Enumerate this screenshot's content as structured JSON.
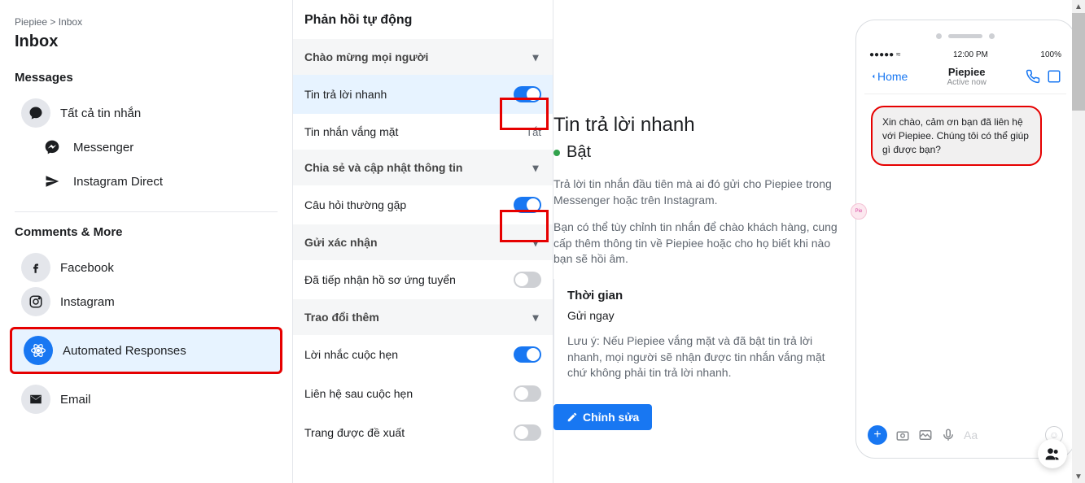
{
  "breadcrumb": {
    "page": "Piepiee",
    "section": "Inbox"
  },
  "inboxTitle": "Inbox",
  "sections": {
    "messages": "Messages",
    "comments": "Comments & More"
  },
  "nav": {
    "all": "Tất cả tin nhắn",
    "messenger": "Messenger",
    "instagramDirect": "Instagram Direct",
    "facebook": "Facebook",
    "instagram": "Instagram",
    "automated": "Automated Responses",
    "email": "Email"
  },
  "middle": {
    "title": "Phản hồi tự động",
    "groups": {
      "welcome": "Chào mừng mọi người",
      "share": "Chia sẻ và cập nhật thông tin",
      "confirm": "Gửi xác nhận",
      "more": "Trao đổi thêm"
    },
    "items": {
      "instantReply": "Tin trả lời nhanh",
      "awayMsg": "Tin nhắn vắng mặt",
      "awayStatus": "Tắt",
      "faq": "Câu hỏi thường gặp",
      "received": "Đã tiếp nhận hồ sơ ứng tuyển",
      "reminder": "Lời nhắc cuộc hẹn",
      "afterContact": "Liên hệ sau cuộc hẹn",
      "suggested": "Trang được đề xuất"
    }
  },
  "detail": {
    "title": "Tin trả lời nhanh",
    "status": "Bật",
    "desc1": "Trả lời tin nhắn đầu tiên mà ai đó gửi cho Piepiee trong Messenger hoặc trên Instagram.",
    "desc2": "Bạn có thể tùy chỉnh tin nhắn để chào khách hàng, cung cấp thêm thông tin về Piepiee hoặc cho họ biết khi nào bạn sẽ hồi âm.",
    "timeTitle": "Thời gian",
    "timeValue": "Gửi ngay",
    "note": "Lưu ý: Nếu Piepiee vắng mặt và đã bật tin trả lời nhanh, mọi người sẽ nhận được tin nhắn vắng mặt chứ không phải tin trả lời nhanh.",
    "editBtn": "Chỉnh sửa"
  },
  "phone": {
    "carrier": "●●●●● ≈",
    "time": "12:00 PM",
    "battery": "100%",
    "home": "Home",
    "name": "Piepiee",
    "sub": "Active now",
    "bubble": "Xin chào, cảm ơn bạn đã liên hệ với Piepiee. Chúng tôi có thể giúp gì được bạn?",
    "placeholder": "Aa"
  }
}
